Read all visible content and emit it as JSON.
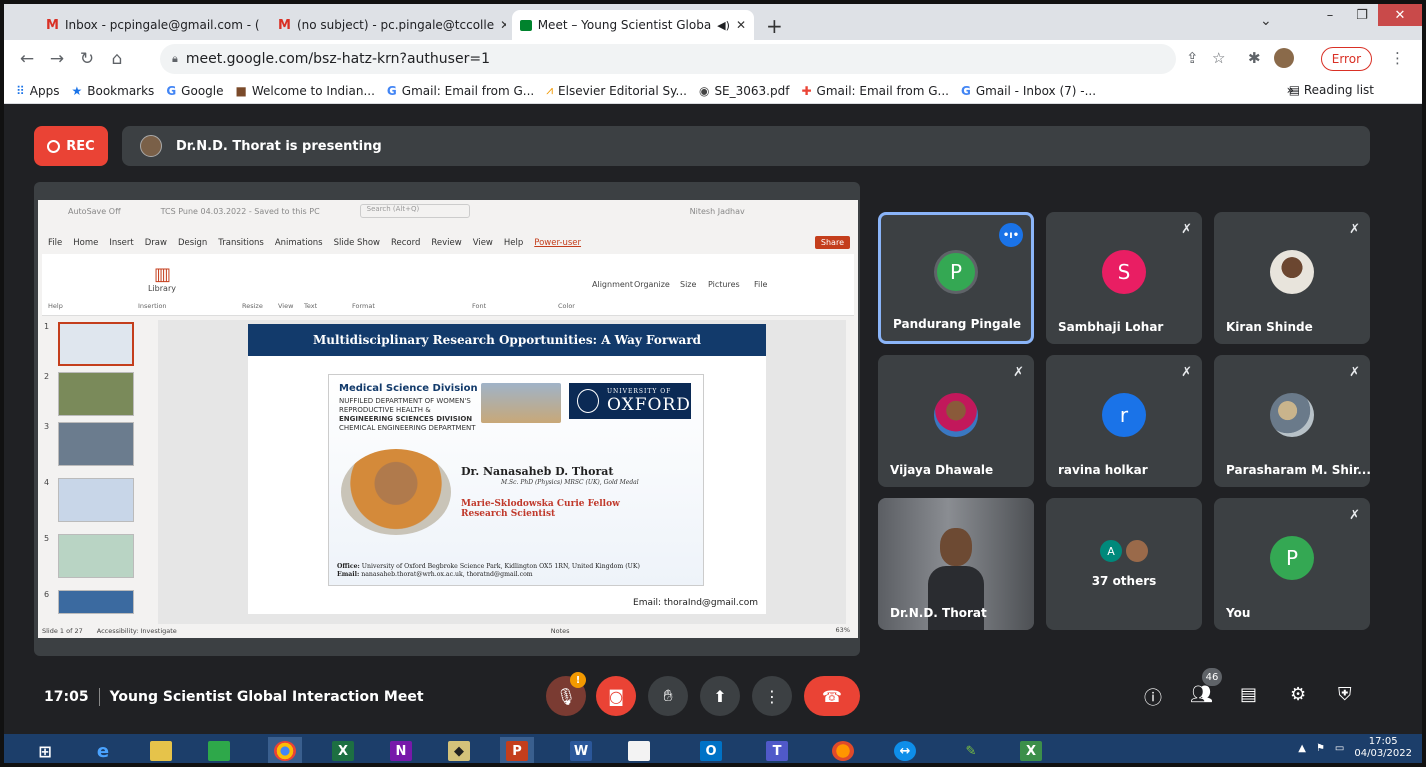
{
  "browser": {
    "tabs": [
      {
        "label": "Inbox - pcpingale@gmail.com - (",
        "icon": "gmail-icon"
      },
      {
        "label": "(no subject) - pc.pingale@tccolle",
        "icon": "gmail-icon"
      },
      {
        "label": "Meet – Young Scientist Globa",
        "icon": "meet-icon",
        "active": true
      }
    ],
    "url": "meet.google.com/bsz-hatz-krn?authuser=1",
    "error_label": "Error",
    "bookmarks": [
      "Apps",
      "Bookmarks",
      "Google",
      "Welcome to Indian...",
      "Gmail: Email from G...",
      "Elsevier Editorial Sy...",
      "SE_3063.pdf",
      "Gmail: Email from G...",
      "Gmail - Inbox (7) -..."
    ],
    "reading_list": "Reading list",
    "more": "»"
  },
  "meet": {
    "rec_label": "REC",
    "presenting_text": "Dr.N.D. Thorat is presenting",
    "meeting_time": "17:05",
    "meeting_title": "Young Scientist Global Interaction Meet",
    "participant_count": "46",
    "mic_warning": "!",
    "tiles": [
      {
        "name": "Pandurang Pingale",
        "initial": "P",
        "color": "#34a853"
      },
      {
        "name": "Sambhaji Lohar",
        "initial": "S",
        "color": "#e91e63"
      },
      {
        "name": "Kiran Shinde"
      },
      {
        "name": "Vijaya Dhawale"
      },
      {
        "name": "ravina holkar",
        "initial": "r",
        "color": "#1a73e8"
      },
      {
        "name": "Parasharam M. Shir..."
      },
      {
        "name": "Dr.N.D. Thorat"
      },
      {
        "name": "37 others",
        "initial": "A"
      },
      {
        "name": "You",
        "initial": "P",
        "color": "#34a853"
      }
    ]
  },
  "ppt": {
    "autosave": "AutoSave",
    "autosave_state": "Off",
    "doc_title": "TCS Pune 04.03.2022 - Saved to this PC",
    "search_placeholder": "Search (Alt+Q)",
    "user": "Nitesh Jadhav",
    "menu": [
      "File",
      "Home",
      "Insert",
      "Draw",
      "Design",
      "Transitions",
      "Animations",
      "Slide Show",
      "Record",
      "Review",
      "View",
      "Help",
      "Power-user"
    ],
    "share": "Share",
    "ribbon_groups": [
      "Help",
      "Insertion",
      "Resize",
      "View",
      "Text",
      "Format",
      "Font",
      "Color"
    ],
    "ribbon_buttons": [
      "Library",
      "Alignment",
      "Organize",
      "Size",
      "Pictures",
      "File"
    ],
    "status_slide": "Slide 1 of 27",
    "status_access": "Accessibility: Investigate",
    "status_notes": "Notes",
    "zoom": "63%",
    "thumb_numbers": [
      "1",
      "2",
      "3",
      "4",
      "5",
      "6"
    ]
  },
  "slide": {
    "title": "Multidisciplinary Research Opportunities: A Way Forward",
    "division": "Medical Science Division",
    "dept_lines": [
      "NUFFILED DEPARTMENT OF WOMEN'S",
      "REPRODUCTIVE HEALTH &",
      "ENGINEERING SCIENCES DIVISION",
      "CHEMICAL ENGINEERING DEPARTMENT"
    ],
    "uni_small": "UNIVERSITY OF",
    "uni_big": "OXFORD",
    "name": "Dr. Nanasaheb D. Thorat",
    "qualifications": "M.Sc. PhD (Physics) MRSC (UK), Gold Medal",
    "fellow_1": "Marie-Sklodowska Curie Fellow",
    "fellow_2": "Research Scientist",
    "office_label": "Office:",
    "office_text": "University of Oxford Begbroke Science Park, Kidlington OX5 1RN, United Kingdom (UK)",
    "email_label": "Email:",
    "email_text": "nanasaheb.thorat@wrh.ox.ac.uk, thoratnd@gmail.com",
    "footer_email": "Email: thoraInd@gmail.com"
  },
  "taskbar": {
    "time": "17:05",
    "date": "04/03/2022"
  }
}
